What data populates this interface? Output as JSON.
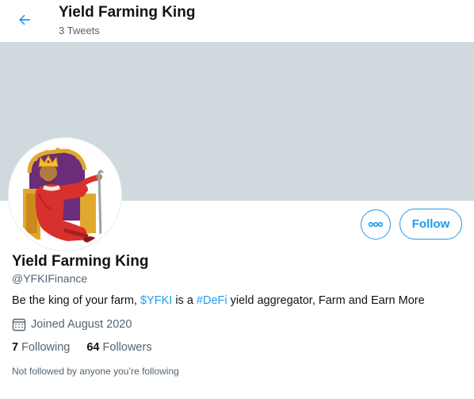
{
  "header": {
    "title": "Yield Farming King",
    "tweet_count": "3 Tweets"
  },
  "colors": {
    "accent": "#1d9bf0",
    "banner": "#cfd9de",
    "text_primary": "#0f1419",
    "text_secondary": "#536471"
  },
  "icons": {
    "back": "arrow-left-icon",
    "more": "more-horizontal-icon",
    "calendar": "calendar-icon"
  },
  "actions": {
    "follow_label": "Follow"
  },
  "profile": {
    "name": "Yield Farming King",
    "handle": "@YFKIFinance",
    "bio": {
      "part1": "Be the king of your farm, ",
      "cashtag": "$YFKI",
      "part2": " is a ",
      "hashtag": "#DeFi",
      "part3": " yield aggregator, Farm and Earn More"
    },
    "joined": "Joined August 2020",
    "following_count": "7",
    "following_label": "Following",
    "followers_count": "64",
    "followers_label": "Followers",
    "not_followed_note": "Not followed by anyone you’re following"
  }
}
